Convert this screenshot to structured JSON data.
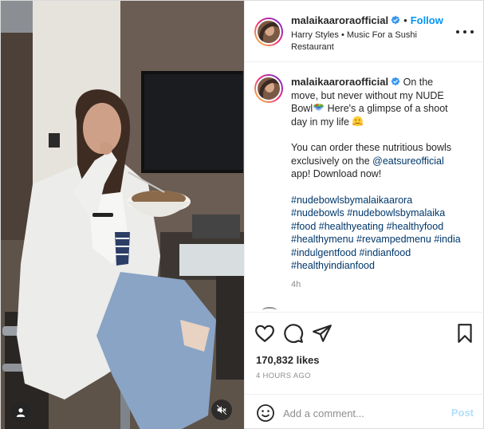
{
  "header": {
    "username": "malaikaaroraofficial",
    "separator": "•",
    "follow_label": "Follow",
    "music": "Harry Styles • Music For a Sushi Restaurant",
    "more_icon": "more-horizontal-icon"
  },
  "caption": {
    "username": "malaikaaroraofficial",
    "line1": " On the move, but never without my NUDE Bowl",
    "line2": " Here's a glimpse of a shoot day in my life ",
    "para2_before": "You can order these nutritious bowls exclusively on the ",
    "mention": "@eatsureofficial",
    "para2_after": " app! Download now!",
    "hashtags": [
      "#nudebowlsbymalaikaarora",
      "#nudebowls",
      "#nudebowlsbymalaika",
      "#food",
      "#healthyeating",
      "#healthyfood",
      "#healthymenu",
      "#revampedmenu",
      "#india",
      "#indulgentfood",
      "#indianfood",
      "#healthyindianfood"
    ],
    "time_ago": "4h"
  },
  "actions": {
    "likes": "170,832 likes",
    "timestamp": "4 HOURS AGO"
  },
  "comment_box": {
    "placeholder": "Add a comment...",
    "post_label": "Post"
  },
  "colors": {
    "follow_blue": "#0095f6",
    "hashtag_blue": "#00376b",
    "post_disabled": "#b2dffc",
    "verified_blue": "#3897f0"
  },
  "icons": [
    "user-tags-icon",
    "mute-icon",
    "verified-badge-icon",
    "bowl-emoji-icon",
    "hug-emoji-icon",
    "heart-icon",
    "comment-icon",
    "share-icon",
    "bookmark-icon",
    "emoji-icon"
  ]
}
